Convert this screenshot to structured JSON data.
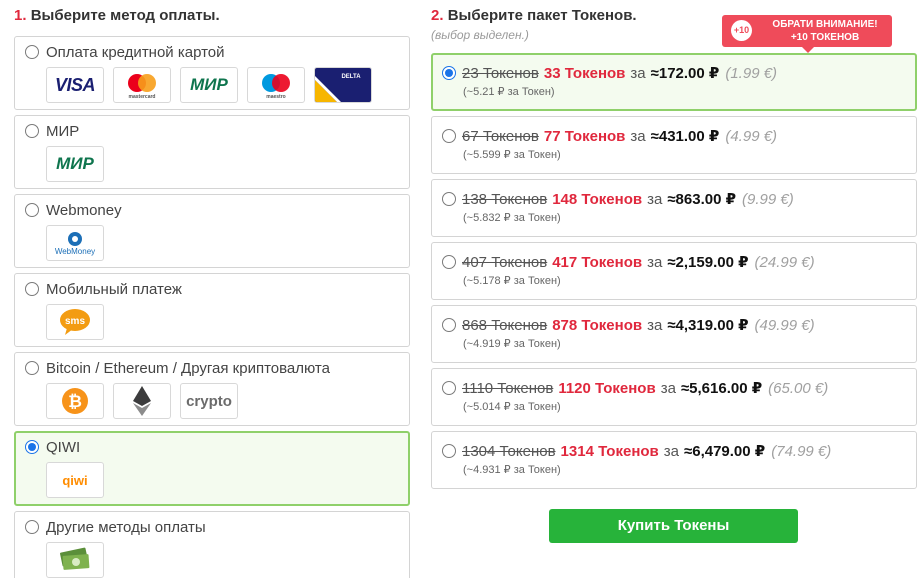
{
  "left": {
    "step_number": "1.",
    "title": "Выберите метод оплаты.",
    "methods": [
      {
        "label": "Оплата кредитной картой",
        "selected": false,
        "logos": [
          "VISA",
          "mastercard",
          "МИР",
          "maestro",
          "DELTA"
        ]
      },
      {
        "label": "МИР",
        "selected": false,
        "logos": [
          "МИР"
        ]
      },
      {
        "label": "Webmoney",
        "selected": false,
        "logos": [
          "WebMoney"
        ]
      },
      {
        "label": "Мобильный платеж",
        "selected": false,
        "logos": [
          "sms"
        ]
      },
      {
        "label": "Bitcoin / Ethereum / Другая криптовалюта",
        "selected": false,
        "logos": [
          "bitcoin",
          "ethereum",
          "crypto"
        ]
      },
      {
        "label": "QIWI",
        "selected": true,
        "logos": [
          "qiwi"
        ]
      },
      {
        "label": "Другие методы оплаты",
        "selected": false,
        "logos": [
          "cash"
        ]
      }
    ]
  },
  "right": {
    "step_number": "2.",
    "title": "Выберите пакет Токенов.",
    "subtitle": "(выбор выделен.)",
    "notice": {
      "badge": "+10",
      "line1": "ОБРАТИ ВНИМАНИЕ!",
      "line2": "+10 ТОКЕНОВ"
    },
    "packages": [
      {
        "old": "23 Токенов",
        "new": "33 Токенов",
        "za": "за",
        "price": "≈172.00 ₽",
        "eur": "(1.99 €)",
        "per": "(~5.21 ₽ за Токен)",
        "selected": true
      },
      {
        "old": "67 Токенов",
        "new": "77 Токенов",
        "za": "за",
        "price": "≈431.00 ₽",
        "eur": "(4.99 €)",
        "per": "(~5.599 ₽ за Токен)",
        "selected": false
      },
      {
        "old": "138 Токенов",
        "new": "148 Токенов",
        "za": "за",
        "price": "≈863.00 ₽",
        "eur": "(9.99 €)",
        "per": "(~5.832 ₽ за Токен)",
        "selected": false
      },
      {
        "old": "407 Токенов",
        "new": "417 Токенов",
        "za": "за",
        "price": "≈2,159.00 ₽",
        "eur": "(24.99 €)",
        "per": "(~5.178 ₽ за Токен)",
        "selected": false
      },
      {
        "old": "868 Токенов",
        "new": "878 Токенов",
        "za": "за",
        "price": "≈4,319.00 ₽",
        "eur": "(49.99 €)",
        "per": "(~4.919 ₽ за Токен)",
        "selected": false
      },
      {
        "old": "1110 Токенов",
        "new": "1120 Токенов",
        "za": "за",
        "price": "≈5,616.00 ₽",
        "eur": "(65.00 €)",
        "per": "(~5.014 ₽ за Токен)",
        "selected": false
      },
      {
        "old": "1304 Токенов",
        "new": "1314 Токенов",
        "za": "за",
        "price": "≈6,479.00 ₽",
        "eur": "(74.99 €)",
        "per": "(~4.931 ₽ за Токен)",
        "selected": false
      }
    ],
    "buy_label": "Купить Токены"
  },
  "colors": {
    "accent_red": "#e0283d",
    "selected_border": "#8fd06a",
    "radio_blue": "#1a73e8",
    "buy_green": "#27b33a"
  }
}
